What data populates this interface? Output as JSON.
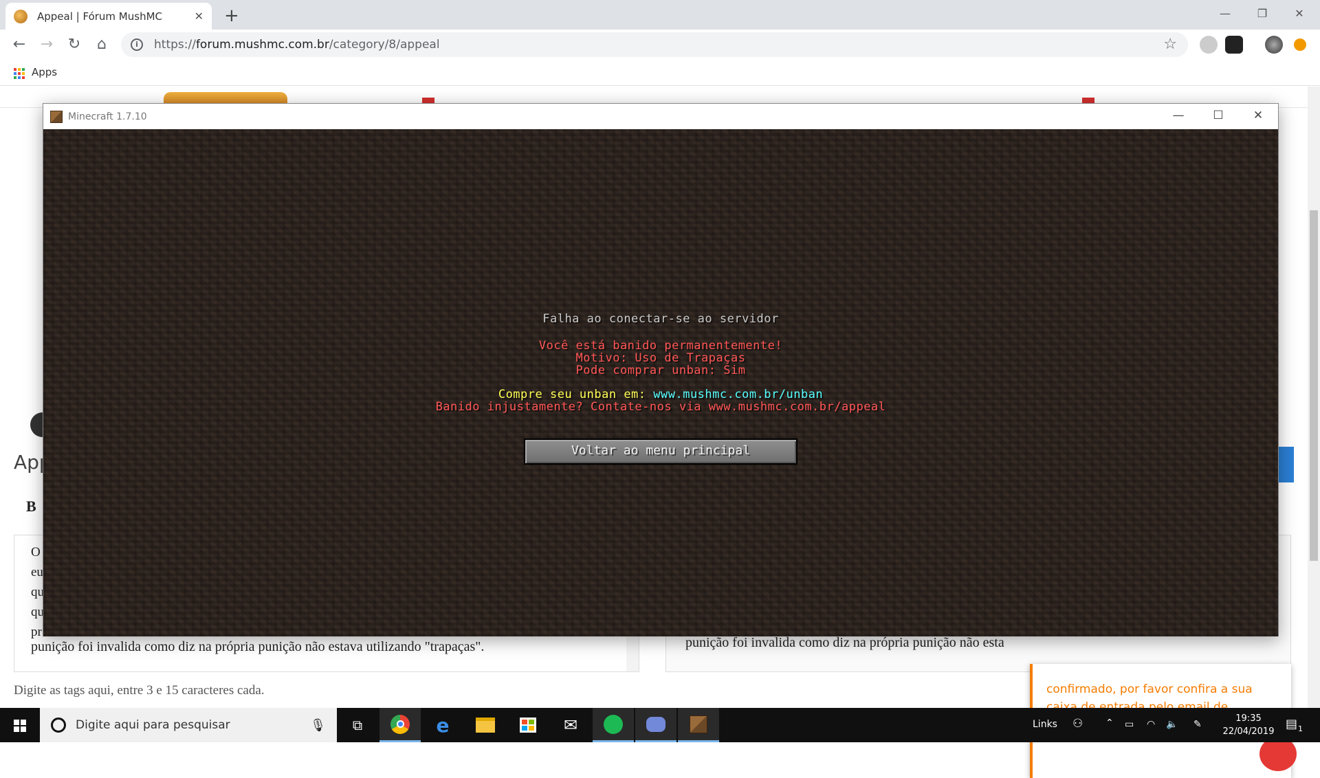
{
  "browser": {
    "tab_title": "Appeal | Fórum MushMC",
    "tab_close": "✕",
    "new_tab": "+",
    "url_scheme": "https://",
    "url_host": "forum.mushmc.com.br",
    "url_path": "/category/8/appeal",
    "bookmarks_apps": "Apps",
    "window_min": "—",
    "window_max": "❐",
    "window_close": "✕"
  },
  "forum": {
    "title_fragment": "App",
    "bold_button": "B",
    "editor_text": "punição foi invalida como diz na própria punição não estava utilizando \"trapaças\".",
    "editor_partial_lines": [
      "O",
      "eu",
      "qu",
      "qu",
      "pr"
    ],
    "preview_text": "punição foi invalida como diz na própria punição não esta",
    "tags_hint": "Digite as tags aqui, entre 3 e 15 caracteres cada.",
    "toast_text": "confirmado, por favor confira a sua caixa de entrada pelo email de confirmação."
  },
  "minecraft": {
    "window_title": "Minecraft 1.7.10",
    "heading": "Falha ao conectar-se ao servidor",
    "ban_line1": "Você está banido permanentemente!",
    "ban_line2": "Motivo: Uso de Trapaças",
    "ban_line3": "Pode comprar unban: Sim",
    "buy_prefix": "Compre seu unban em: ",
    "buy_url": "www.mushmc.com.br/unban",
    "appeal_line": "Banido injustamente? Contate-nos via www.mushmc.com.br/appeal",
    "back_button": "Voltar ao menu principal",
    "colors": {
      "gray": "#c8c8c8",
      "red": "#ff5555",
      "yellow": "#ffff55",
      "cyan": "#55ffff"
    }
  },
  "taskbar": {
    "search_placeholder": "Digite aqui para pesquisar",
    "links": "Links",
    "time": "19:35",
    "date": "22/04/2019",
    "notification_count": "1",
    "apps": [
      "task-view",
      "chrome",
      "edge",
      "file-explorer",
      "store",
      "mail",
      "spotify",
      "discord",
      "minecraft"
    ]
  }
}
